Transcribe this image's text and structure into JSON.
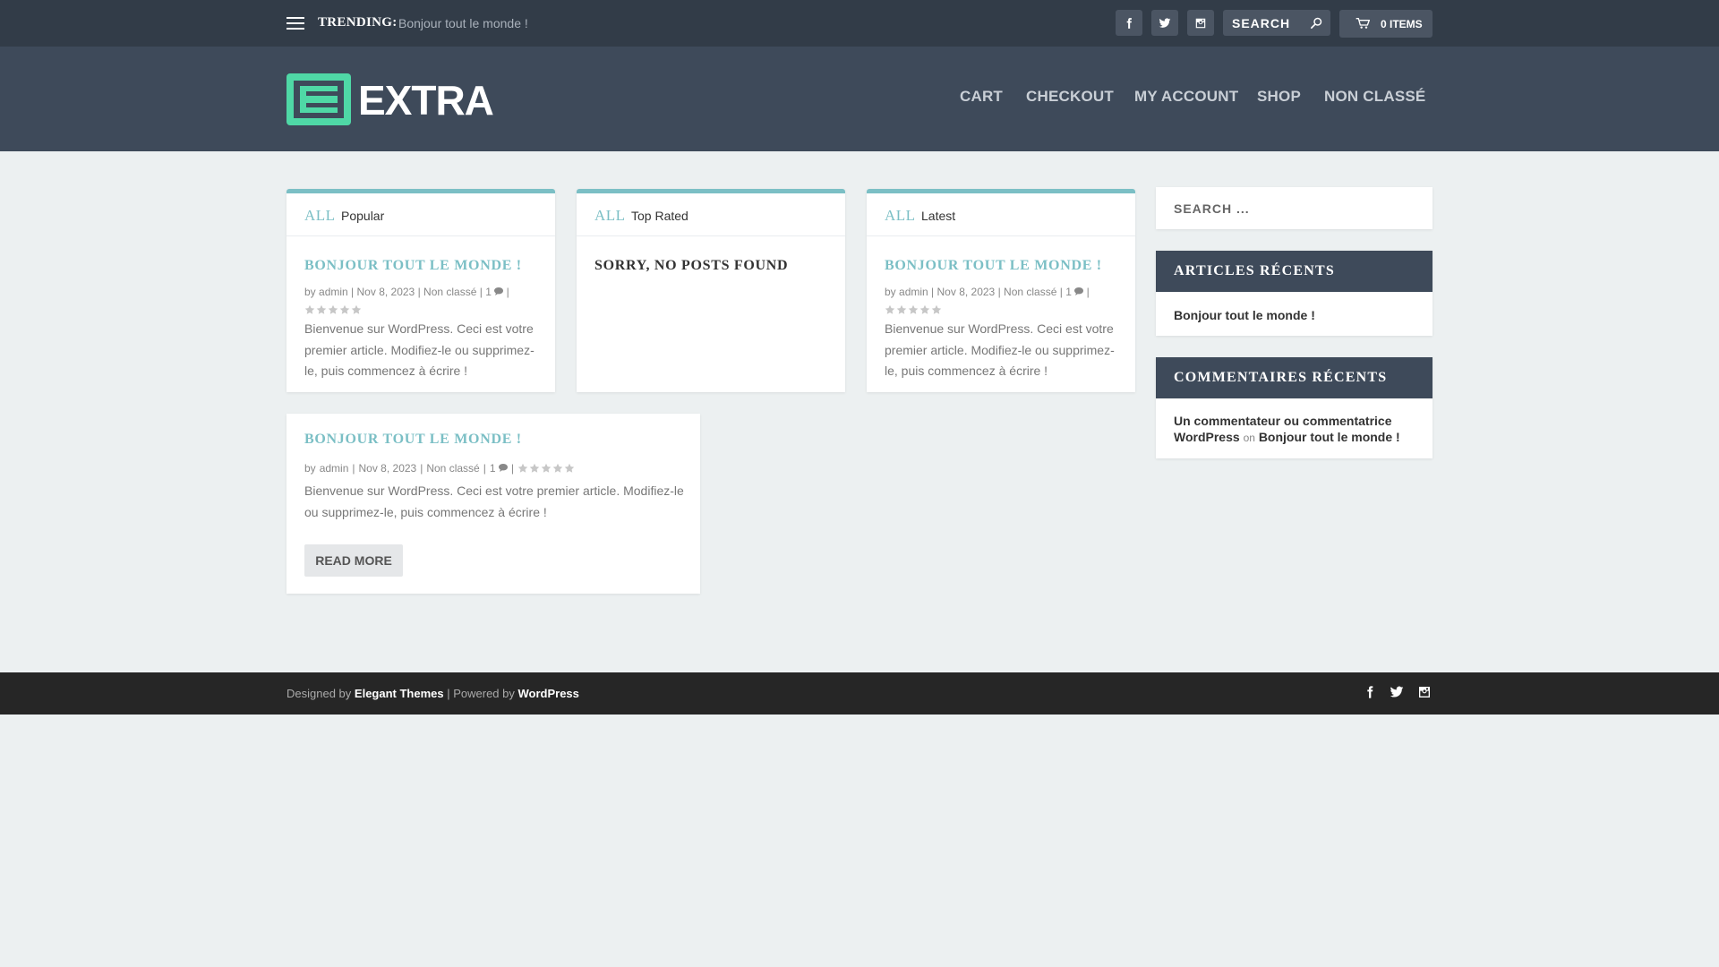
{
  "topbar": {
    "trending_label": "TRENDING:",
    "trending_link": "Bonjour tout le monde !",
    "search_placeholder": "SEARCH",
    "cart_label": "0 ITEMS"
  },
  "header": {
    "logo_text": "EXTRA",
    "nav": [
      "CART",
      "CHECKOUT",
      "MY ACCOUNT",
      "SHOP",
      "NON CLASSÉ"
    ]
  },
  "tabs": [
    {
      "all": "ALL",
      "name": "Popular",
      "post": {
        "title": "BONJOUR TOUT LE MONDE !",
        "by": "by",
        "author": "admin",
        "date": "Nov 8, 2023",
        "category": "Non classé",
        "comments": "1",
        "excerpt": "Bienvenue sur WordPress. Ceci est votre premier article. Modifiez-le ou supprimez-le, puis commencez à écrire !"
      }
    },
    {
      "all": "ALL",
      "name": "Top Rated",
      "empty_text": "SORRY, NO POSTS FOUND"
    },
    {
      "all": "ALL",
      "name": "Latest",
      "post": {
        "title": "BONJOUR TOUT LE MONDE !",
        "by": "by",
        "author": "admin",
        "date": "Nov 8, 2023",
        "category": "Non classé",
        "comments": "1",
        "excerpt": "Bienvenue sur WordPress. Ceci est votre premier article. Modifiez-le ou supprimez-le, puis commencez à écrire !"
      }
    }
  ],
  "feature_post": {
    "title": "BONJOUR TOUT LE MONDE !",
    "by": "by",
    "author": "admin",
    "date": "Nov 8, 2023",
    "category": "Non classé",
    "comments": "1",
    "excerpt": "Bienvenue sur WordPress. Ceci est votre premier article. Modifiez-le ou supprimez-le, puis commencez à écrire !",
    "read_more": "READ MORE"
  },
  "sidebar": {
    "search_placeholder": "SEARCH ...",
    "recent_posts_title": "ARTICLES RÉCENTS",
    "recent_post": "Bonjour tout le monde !",
    "recent_comments_title": "COMMENTAIRES RÉCENTS",
    "comment_author": "Un commentateur ou commentatrice WordPress",
    "comment_on": "on",
    "comment_post": "Bonjour tout le monde !"
  },
  "footer": {
    "designed_by": "Designed by",
    "theme_link": "Elegant Themes",
    "separator": "| Powered by",
    "wp_link": "WordPress"
  },
  "colors": {
    "topbar": "#323c48",
    "header": "#3e4a5a",
    "accent": "#7bbfc5",
    "logo": "#4fd8a6",
    "page_bg": "#ecf0f1",
    "footer": "#262626"
  },
  "icons": {
    "menu": "hamburger-icon",
    "facebook": "facebook-icon",
    "twitter": "twitter-icon",
    "instagram": "instagram-icon",
    "search": "search-icon",
    "cart": "cart-icon",
    "comment": "comment-bubble-icon",
    "star": "star-icon"
  }
}
